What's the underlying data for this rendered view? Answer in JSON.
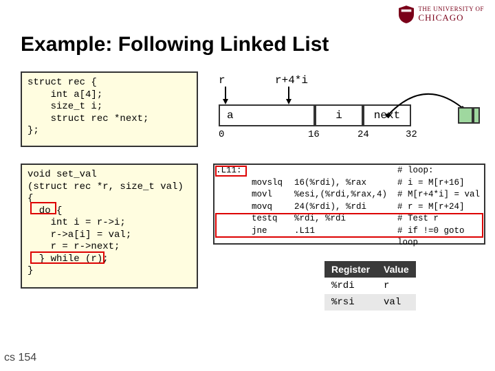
{
  "logo": {
    "line1": "THE UNIVERSITY OF",
    "line2": "CHICAGO"
  },
  "title": "Example: Following Linked List",
  "struct_code": "struct rec {\n    int a[4];\n    size_t i;\n    struct rec *next;\n};",
  "func_code": "void set_val\n(struct rec *r, size_t val)\n{\n  do {\n    int i = r->i;\n    r->a[i] = val;\n    r = r->next;\n  } while (r);\n}",
  "diagram": {
    "ptr_r": "r",
    "ptr_r4i": "r+4*i",
    "fields": {
      "a": "a",
      "i": "i",
      "next": "next"
    },
    "offsets": {
      "o0": "0",
      "o16": "16",
      "o24": "24",
      "o32": "32"
    }
  },
  "asm": {
    "rows": [
      {
        "lab": ".L11:",
        "op": "",
        "arg": "",
        "cmt": "# loop:"
      },
      {
        "lab": "",
        "op": "movslq",
        "arg": "16(%rdi), %rax",
        "cmt": "# i = M[r+16]"
      },
      {
        "lab": "",
        "op": "movl",
        "arg": "%esi,(%rdi,%rax,4)",
        "cmt": "# M[r+4*i] = val"
      },
      {
        "lab": "",
        "op": "movq",
        "arg": "24(%rdi), %rdi",
        "cmt": "# r = M[r+24]"
      },
      {
        "lab": "",
        "op": "testq",
        "arg": "%rdi, %rdi",
        "cmt": "# Test r"
      },
      {
        "lab": "",
        "op": "jne",
        "arg": ".L11",
        "cmt": "# if !=0 goto loop"
      }
    ]
  },
  "reg_table": {
    "headers": {
      "reg": "Register",
      "val": "Value"
    },
    "rows": [
      {
        "reg": "%rdi",
        "val": "r"
      },
      {
        "reg": "%rsi",
        "val": "val"
      }
    ]
  },
  "footer": "cs 154"
}
